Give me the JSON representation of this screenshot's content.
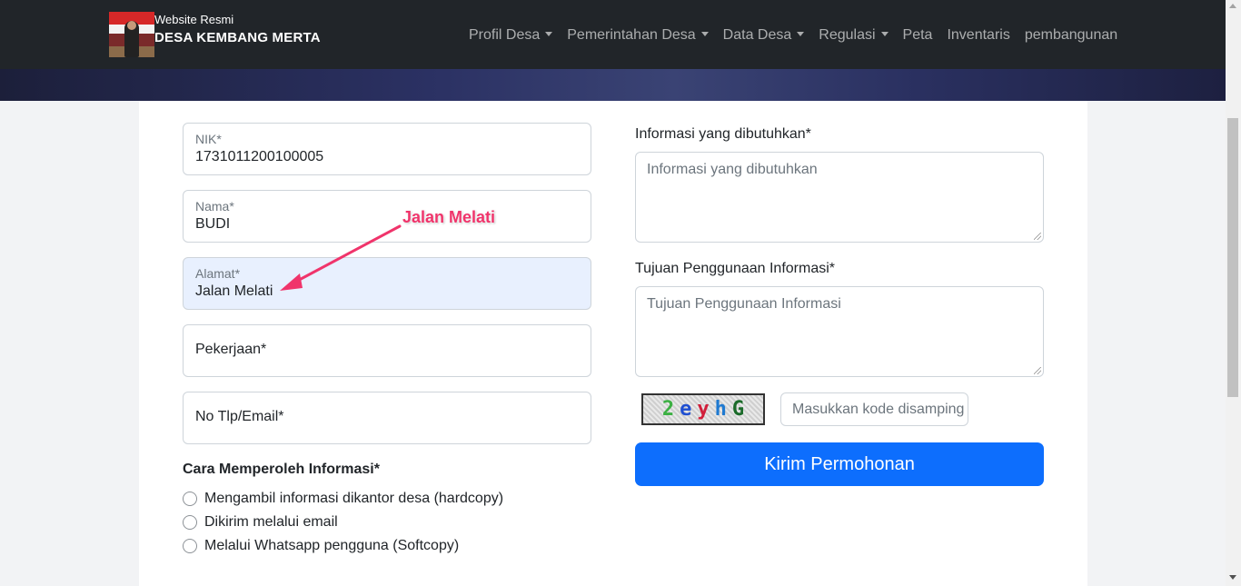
{
  "navbar": {
    "brand_small": "Website Resmi",
    "brand_big": "DESA KEMBANG MERTA",
    "items": [
      {
        "label": "Profil Desa",
        "dropdown": true
      },
      {
        "label": "Pemerintahan Desa",
        "dropdown": true
      },
      {
        "label": "Data Desa",
        "dropdown": true
      },
      {
        "label": "Regulasi",
        "dropdown": true
      },
      {
        "label": "Peta",
        "dropdown": false
      },
      {
        "label": "Inventaris",
        "dropdown": false
      },
      {
        "label": "pembangunan",
        "dropdown": false
      }
    ]
  },
  "form": {
    "nik": {
      "label": "NIK*",
      "value": "1731011200100005"
    },
    "nama": {
      "label": "Nama*",
      "value": "BUDI"
    },
    "alamat": {
      "label": "Alamat*",
      "value": "Jalan Melati"
    },
    "pekerjaan": {
      "label": "Pekerjaan*"
    },
    "kontak": {
      "label": "No Tlp/Email*"
    },
    "cara_title": "Cara Memperoleh Informasi*",
    "cara_options": [
      "Mengambil informasi dikantor desa (hardcopy)",
      "Dikirim melalui email",
      "Melalui Whatsapp pengguna (Softcopy)"
    ],
    "informasi": {
      "label": "Informasi yang dibutuhkan*",
      "placeholder": "Informasi yang dibutuhkan"
    },
    "tujuan": {
      "label": "Tujuan Penggunaan Informasi*",
      "placeholder": "Tujuan Penggunaan Informasi"
    },
    "captcha": {
      "chars": [
        {
          "c": "2",
          "color": "#3cb043"
        },
        {
          "c": "e",
          "color": "#1f4fd1"
        },
        {
          "c": "y",
          "color": "#d11f3a"
        },
        {
          "c": "h",
          "color": "#1f7ad1"
        },
        {
          "c": "G",
          "color": "#1b6b2a"
        }
      ],
      "placeholder": "Masukkan kode disamping"
    },
    "submit_label": "Kirim Permohonan"
  },
  "annotation": {
    "text": "Jalan Melati",
    "color": "#f0346b"
  }
}
